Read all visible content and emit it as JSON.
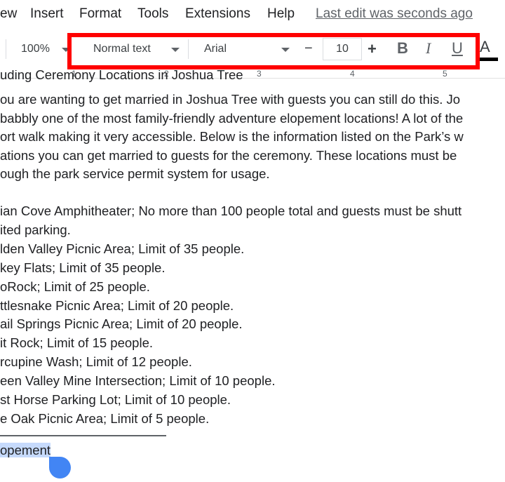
{
  "menubar": {
    "items": [
      "ew",
      "Insert",
      "Format",
      "Tools",
      "Extensions",
      "Help"
    ],
    "last_edit": "Last edit was seconds ago"
  },
  "toolbar": {
    "zoom": "100%",
    "style": "Normal text",
    "font": "Arial",
    "font_size": "10",
    "decrease": "−",
    "increase": "+",
    "bold": "B",
    "italic": "I",
    "underline": "U",
    "text_color": "A",
    "text_color_value": "#000000",
    "highlight_color": "#ff0000"
  },
  "ruler": [
    "1",
    "2",
    "3",
    "4",
    "5"
  ],
  "document": {
    "heading": "uding Ceremony Locations in Joshua Tree",
    "paragraph": [
      "ou are wanting to get married in Joshua Tree with guests you can still do this. Jo",
      "babbly one of the most family-friendly adventure elopement locations! A lot of the",
      "ort walk making it very accessible. Below is the information listed on the Park’s w",
      "ations you can get married to guests for the ceremony. These locations must be",
      "ough the park service permit system for usage."
    ],
    "list": [
      "ian Cove Amphitheater; No more than 100 people total and guests must be shutt",
      "ited parking.",
      "lden Valley Picnic Area; Limit of 35 people.",
      "key Flats; Limit of 35 people.",
      "oRock; Limit of 25 people.",
      "ttlesnake Picnic Area; Limit of 20 people.",
      "ail Springs Picnic Area; Limit of 20 people.",
      "it Rock; Limit of 15 people.",
      "rcupine Wash; Limit of 12 people.",
      "een Valley Mine Intersection; Limit of 10 people.",
      "st Horse Parking Lot; Limit of 10 people.",
      "e Oak Picnic Area; Limit of 5 people."
    ],
    "selected": "opement"
  }
}
